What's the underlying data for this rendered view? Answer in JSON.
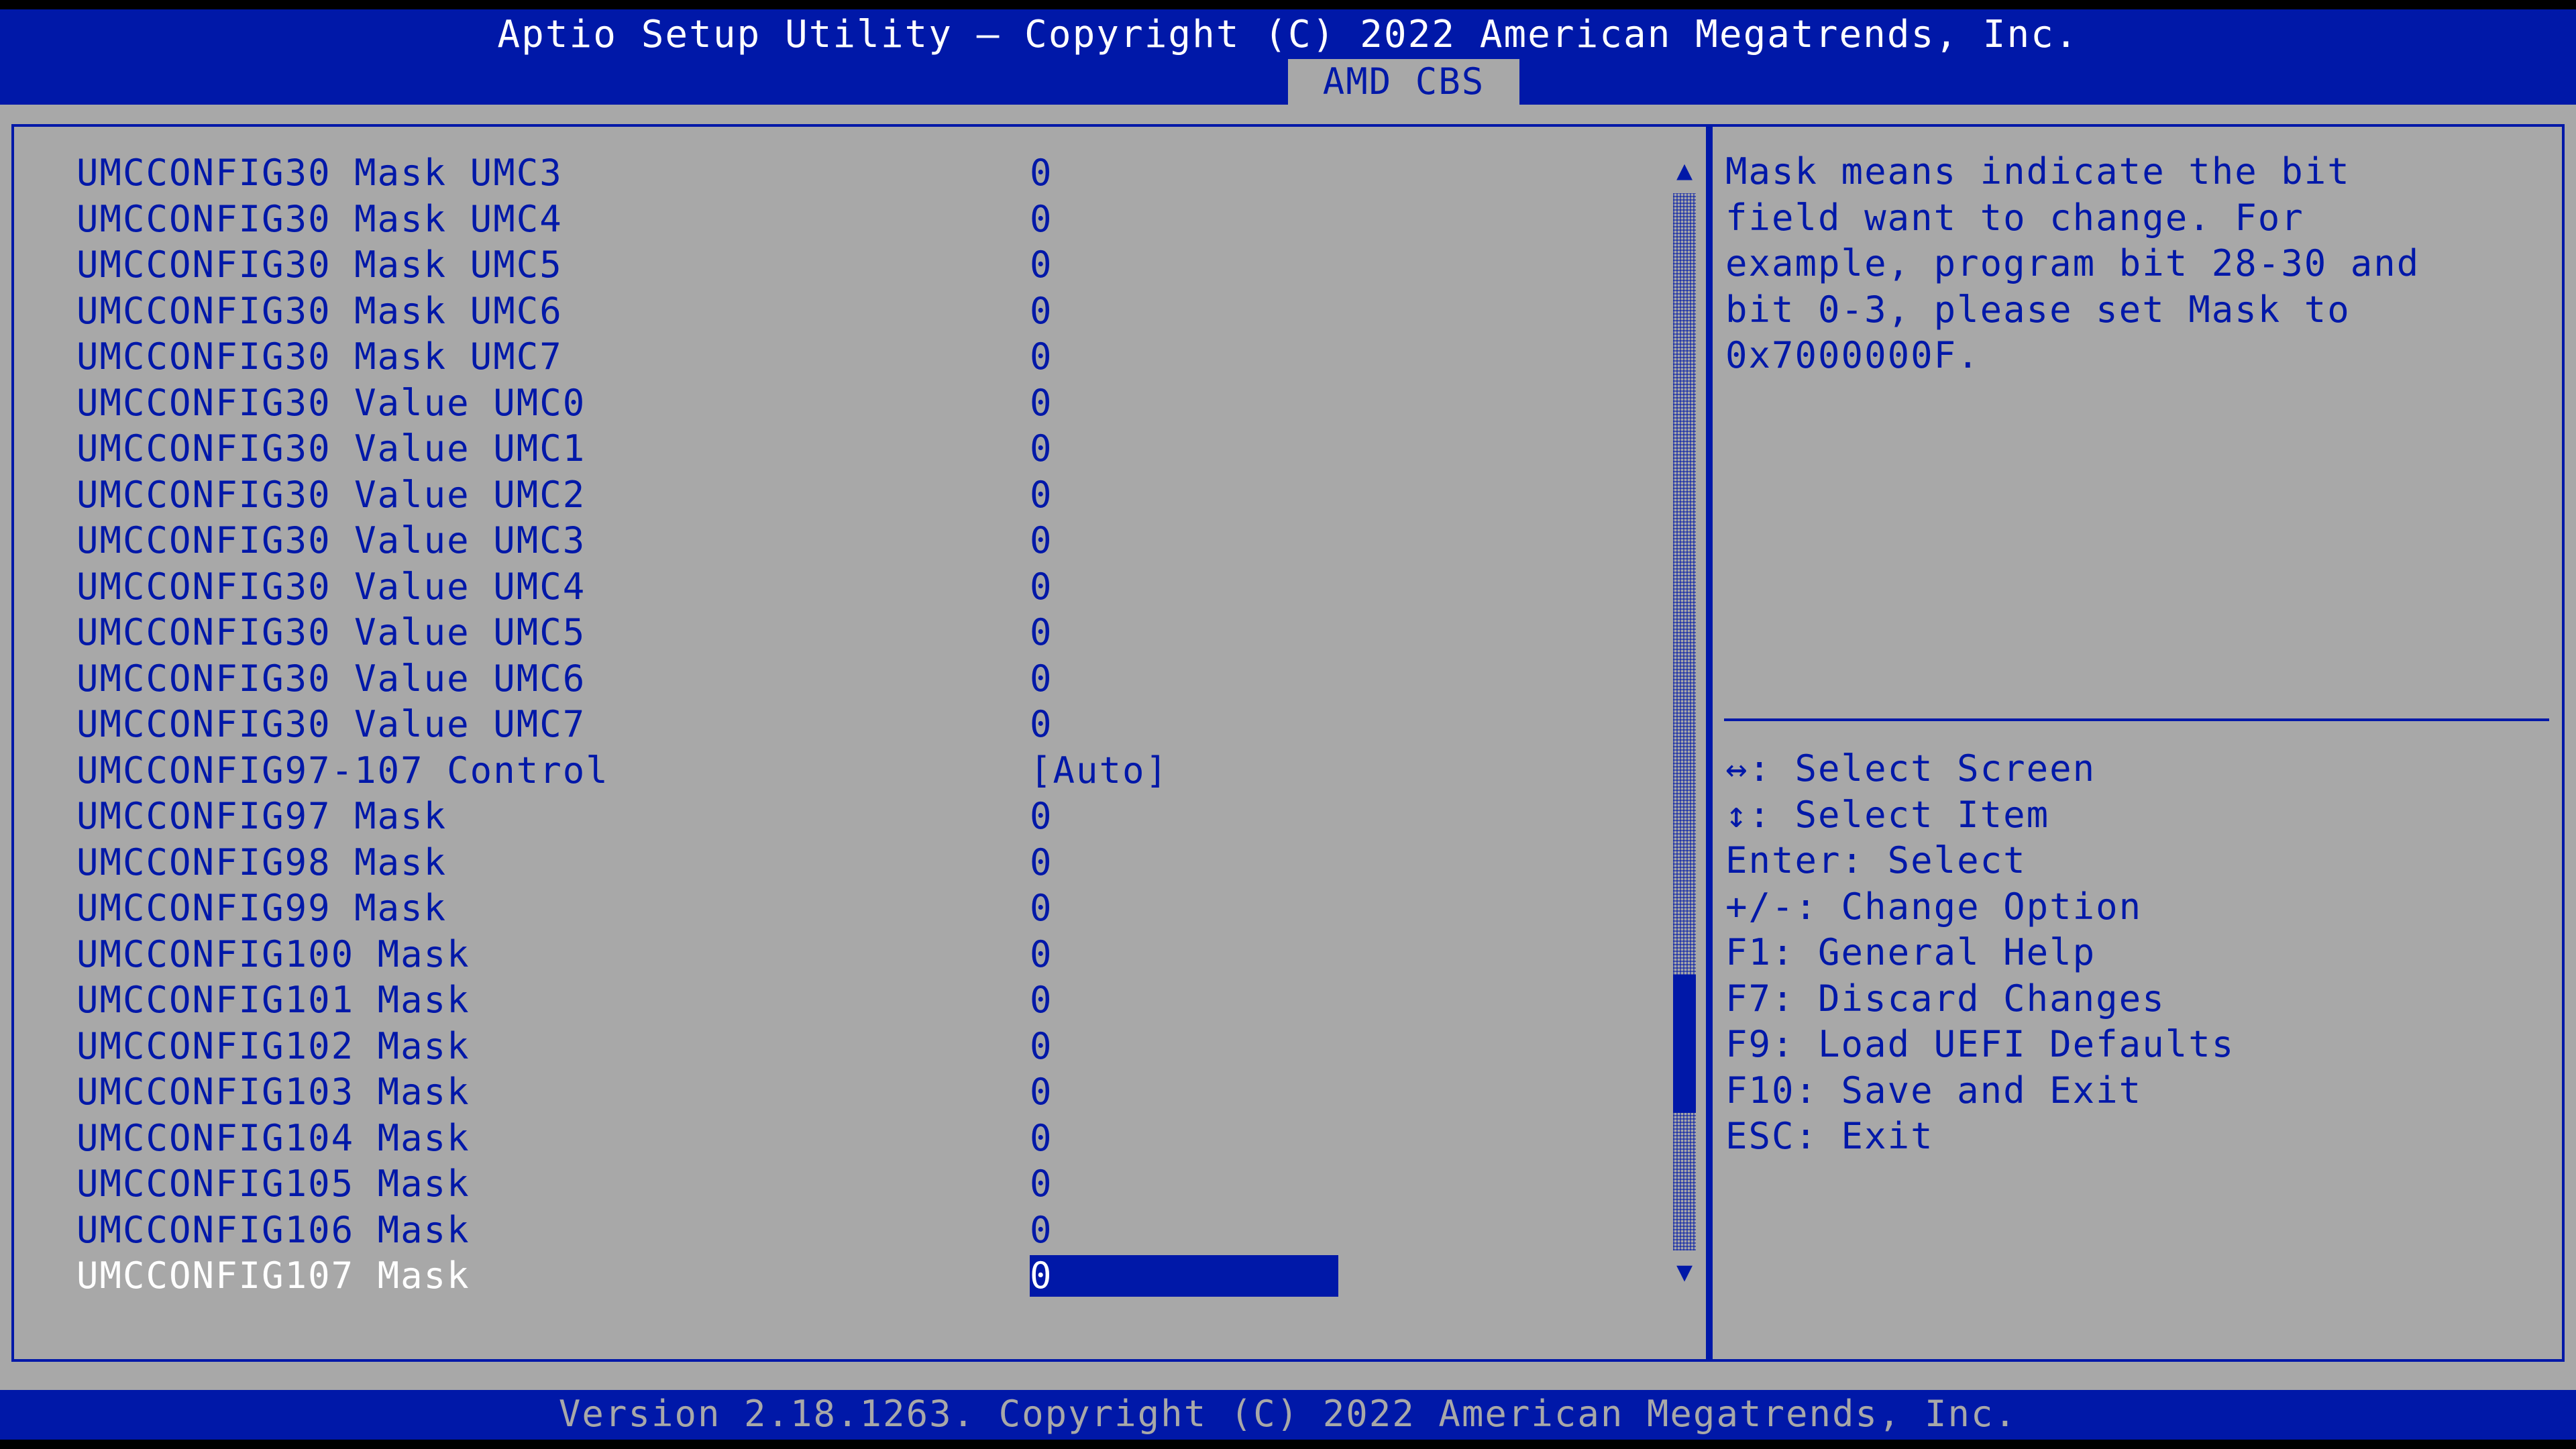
{
  "header": {
    "title": "Aptio Setup Utility – Copyright (C) 2022 American Megatrends, Inc.",
    "active_tab": "AMD CBS"
  },
  "settings": [
    {
      "label": "UMCCONFIG30 Mask UMC3",
      "value": "0"
    },
    {
      "label": "UMCCONFIG30 Mask UMC4",
      "value": "0"
    },
    {
      "label": "UMCCONFIG30 Mask UMC5",
      "value": "0"
    },
    {
      "label": "UMCCONFIG30 Mask UMC6",
      "value": "0"
    },
    {
      "label": "UMCCONFIG30 Mask UMC7",
      "value": "0"
    },
    {
      "label": "UMCCONFIG30 Value UMC0",
      "value": "0"
    },
    {
      "label": "UMCCONFIG30 Value UMC1",
      "value": "0"
    },
    {
      "label": "UMCCONFIG30 Value UMC2",
      "value": "0"
    },
    {
      "label": "UMCCONFIG30 Value UMC3",
      "value": "0"
    },
    {
      "label": "UMCCONFIG30 Value UMC4",
      "value": "0"
    },
    {
      "label": "UMCCONFIG30 Value UMC5",
      "value": "0"
    },
    {
      "label": "UMCCONFIG30 Value UMC6",
      "value": "0"
    },
    {
      "label": "UMCCONFIG30 Value UMC7",
      "value": "0"
    },
    {
      "label": "UMCCONFIG97-107 Control",
      "value": "[Auto]"
    },
    {
      "label": "UMCCONFIG97 Mask",
      "value": "0"
    },
    {
      "label": "UMCCONFIG98 Mask",
      "value": "0"
    },
    {
      "label": "UMCCONFIG99 Mask",
      "value": "0"
    },
    {
      "label": "UMCCONFIG100 Mask",
      "value": "0"
    },
    {
      "label": "UMCCONFIG101 Mask",
      "value": "0"
    },
    {
      "label": "UMCCONFIG102 Mask",
      "value": "0"
    },
    {
      "label": "UMCCONFIG103 Mask",
      "value": "0"
    },
    {
      "label": "UMCCONFIG104 Mask",
      "value": "0"
    },
    {
      "label": "UMCCONFIG105 Mask",
      "value": "0"
    },
    {
      "label": "UMCCONFIG106 Mask",
      "value": "0"
    },
    {
      "label": "UMCCONFIG107 Mask",
      "value": "0",
      "selected": true
    }
  ],
  "scrollbar": {
    "up_arrow": "▲",
    "down_arrow": "▼"
  },
  "help": {
    "lines": [
      "Mask means indicate the bit",
      "field want to change. For",
      "example, program bit 28-30 and",
      "bit 0-3, please set Mask to",
      "0x7000000F."
    ]
  },
  "key_help": [
    "↔: Select Screen",
    "↕: Select Item",
    "Enter: Select",
    "+/-: Change Option",
    "F1: General Help",
    "F7: Discard Changes",
    "F9: Load UEFI Defaults",
    "F10: Save and Exit",
    "ESC: Exit"
  ],
  "footer": {
    "version": "Version 2.18.1263. Copyright (C) 2022 American Megatrends, Inc."
  },
  "colors": {
    "bios_blue": "#0018a8",
    "panel_gray": "#a8a8a8",
    "highlight_text": "#ffffff"
  }
}
